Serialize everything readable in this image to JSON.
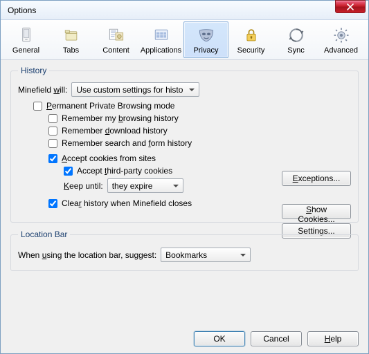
{
  "window": {
    "title": "Options"
  },
  "tabs": {
    "general": "General",
    "tabs": "Tabs",
    "content": "Content",
    "applications": "Applications",
    "privacy": "Privacy",
    "security": "Security",
    "sync": "Sync",
    "advanced": "Advanced"
  },
  "history": {
    "legend": "History",
    "will_html": "Minefield <span class='u'>w</span>ill:",
    "mode_options": [
      "Use custom settings for history"
    ],
    "mode_selected": "Use custom settings for history",
    "permanent_html": "<span class='u'>P</span>ermanent Private Browsing mode",
    "remember_browsing_html": "Remember my <span class='u'>b</span>rowsing history",
    "remember_download_html": "Remember <span class='u'>d</span>ownload history",
    "remember_forms_html": "Remember search and <span class='u'>f</span>orm history",
    "accept_cookies_html": "<span class='u'>A</span>ccept cookies from sites",
    "accept_third_html": "Accept <span class='u'>t</span>hird-party cookies",
    "keep_until_html": "<span class='u'>K</span>eep until:",
    "keep_until_selected": "they expire",
    "clear_on_close_html": "Clea<span class='u'>r</span> history when Minefield closes",
    "exceptions_html": "<span class='u'>E</span>xceptions...",
    "show_cookies_html": "<span class='u'>S</span>how Cookies...",
    "settings_html": "Se<span class='u'>t</span>tings...",
    "chk": {
      "permanent": false,
      "remember_browsing": false,
      "remember_download": false,
      "remember_forms": false,
      "accept_cookies": true,
      "accept_third": true,
      "clear_on_close": true
    }
  },
  "location": {
    "legend": "Location Bar",
    "suggest_html": "When <span class='u'>u</span>sing the location bar, suggest:",
    "suggest_selected": "Bookmarks"
  },
  "footer": {
    "ok": "OK",
    "cancel": "Cancel",
    "help_html": "<span class='u'>H</span>elp"
  }
}
